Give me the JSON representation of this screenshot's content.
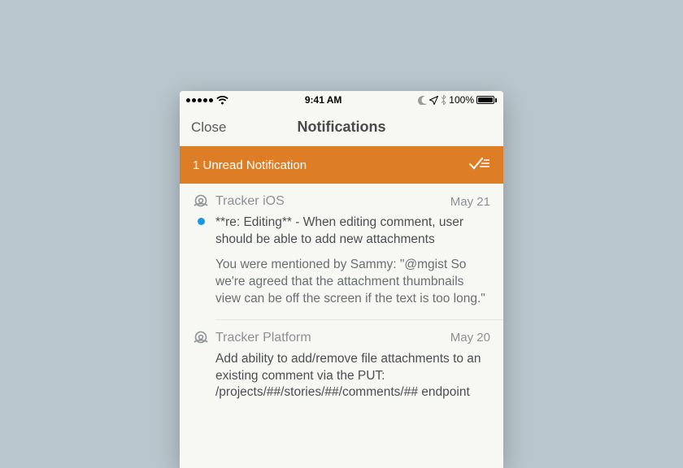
{
  "status": {
    "time": "9:41 AM",
    "battery_pct": "100%"
  },
  "nav": {
    "close": "Close",
    "title": "Notifications"
  },
  "banner": {
    "text": "1 Unread Notification"
  },
  "items": [
    {
      "project": "Tracker iOS",
      "date": "May 21",
      "unread": true,
      "subject": "**re: Editing** - When editing comment, user should be able to add new attachments",
      "detail": "You were mentioned by Sammy: \"@mgist So we're agreed that the attachment thumbnails view can be off the screen if the text is too long.\""
    },
    {
      "project": "Tracker Platform",
      "date": "May 20",
      "unread": false,
      "subject": "Add ability to add/remove file attachments to an existing comment via the PUT: /projects/##/stories/##/comments/## endpoint",
      "detail": ""
    }
  ]
}
